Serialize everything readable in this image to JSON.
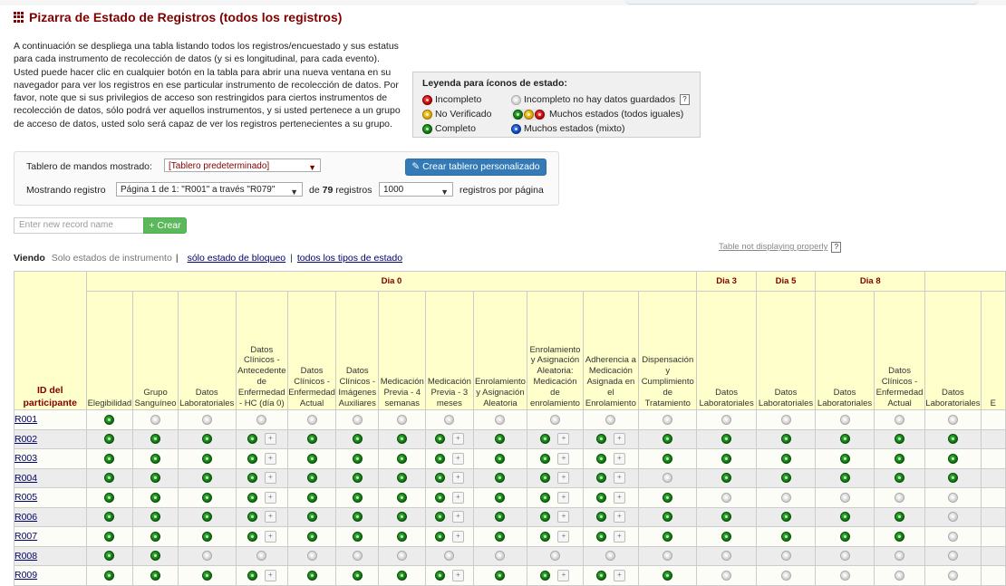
{
  "page": {
    "title": "Pizarra de Estado de Registros (todos los registros)",
    "intro": "A continuación se despliega una tabla listando todos los registros/encuestado y sus estatus para cada instrumento de recolección de datos (y si es longitudinal, para cada evento). Usted puede hacer clic en cualquier botón en la tabla para abrir una nueva ventana en su navegador para ver los registros en ese particular instrumento de recolección de datos. Por favor, note que si sus privilegios de acceso son restringidos para ciertos instrumentos de recolección de datos, sólo podrá ver aquellos instrumentos, y si usted pertenece a un grupo de acceso de datos, usted solo será capaz de ver los registros pertenecientes a su grupo."
  },
  "legend": {
    "title": "Leyenda para íconos de estado:",
    "incomplete": "Incompleto",
    "incomplete_nodata": "Incompleto no hay datos guardados",
    "unverified": "No Verificado",
    "many_same": "Muchos estados (todos iguales)",
    "complete": "Completo",
    "many_mixed": "Muchos estados (mixto)",
    "help": "?"
  },
  "dashboard": {
    "shown_label": "Tablero de mandos mostrado:",
    "shown_value": "[Tablero predeterminado]",
    "create_button": "Crear tablero personalizado",
    "showing_label": "Mostrando registro",
    "page_select": "Página 1 de 1: \"R001\" a través \"R079\"",
    "of_label": "de",
    "total": "79",
    "records_label": "registros",
    "per_page_value": "1000",
    "per_page_label": "registros por página"
  },
  "new_record": {
    "placeholder": "Enter new record name",
    "button": "+ Crear"
  },
  "table_notice": "Table not displaying properly",
  "viewing": {
    "label": "Viendo",
    "current": "Solo estados de instrumento",
    "lock": "sólo estado de bloqueo",
    "all": "todos los tipos de estado"
  },
  "table": {
    "id_header": "ID del participante",
    "events": [
      "Dia 0",
      "Dia 3",
      "Dia 5",
      "Dia 8"
    ],
    "forms": [
      "Elegibilidad",
      "Grupo Sanguíneo",
      "Datos Laboratoriales",
      "Datos Clínicos - Antecedente de Enfermedad - HC (día 0)",
      "Datos Clínicos - Enfermedad Actual",
      "Datos Clínicos - Imágenes Auxiliares",
      "Medicación Previa - 4 semanas",
      "Medicación Previa - 3 meses",
      "Enrolamiento y Asignación Aleatoria",
      "Enrolamiento y Asignación Aleatoria: Medicación de enrolamiento",
      "Adherencia a Medicación Asignada en el Enrolamiento",
      "Dispensación y Cumplimiento de Tratamiento",
      "Datos Laboratoriales",
      "Datos Laboratoriales",
      "Datos Laboratoriales",
      "Datos Clínicos - Enfermedad Actual",
      "Datos Laboratoriales",
      "E"
    ],
    "rows": [
      {
        "id": "R001",
        "s": [
          "g",
          "e",
          "e",
          "e",
          "e",
          "e",
          "e",
          "e",
          "e",
          "e",
          "e",
          "e",
          "e",
          "e",
          "e",
          "e",
          "e"
        ],
        "p": []
      },
      {
        "id": "R002",
        "s": [
          "g",
          "g",
          "g",
          "g",
          "g",
          "g",
          "g",
          "g",
          "g",
          "g",
          "g",
          "g",
          "g",
          "g",
          "g",
          "g",
          "g"
        ],
        "p": [
          3,
          7,
          9,
          10
        ]
      },
      {
        "id": "R003",
        "s": [
          "g",
          "g",
          "g",
          "g",
          "g",
          "g",
          "g",
          "g",
          "g",
          "g",
          "g",
          "g",
          "g",
          "g",
          "g",
          "g",
          "g"
        ],
        "p": [
          3,
          7,
          9,
          10
        ]
      },
      {
        "id": "R004",
        "s": [
          "g",
          "g",
          "g",
          "g",
          "g",
          "g",
          "g",
          "g",
          "g",
          "g",
          "g",
          "e",
          "g",
          "g",
          "g",
          "g",
          "g"
        ],
        "p": [
          3,
          7,
          9,
          10
        ]
      },
      {
        "id": "R005",
        "s": [
          "g",
          "g",
          "g",
          "g",
          "g",
          "g",
          "g",
          "g",
          "g",
          "g",
          "g",
          "g",
          "e",
          "e",
          "e",
          "e",
          "e"
        ],
        "p": [
          3,
          7,
          9,
          10
        ]
      },
      {
        "id": "R006",
        "s": [
          "g",
          "g",
          "g",
          "g",
          "g",
          "g",
          "g",
          "g",
          "g",
          "g",
          "g",
          "g",
          "g",
          "g",
          "g",
          "g",
          "e"
        ],
        "p": [
          3,
          7,
          9,
          10
        ]
      },
      {
        "id": "R007",
        "s": [
          "g",
          "g",
          "g",
          "g",
          "g",
          "g",
          "g",
          "g",
          "g",
          "g",
          "g",
          "g",
          "g",
          "g",
          "g",
          "g",
          "e"
        ],
        "p": [
          3,
          7,
          9,
          10
        ]
      },
      {
        "id": "R008",
        "s": [
          "g",
          "g",
          "e",
          "e",
          "e",
          "e",
          "e",
          "e",
          "e",
          "e",
          "e",
          "e",
          "e",
          "e",
          "e",
          "e",
          "e"
        ],
        "p": []
      },
      {
        "id": "R009",
        "s": [
          "g",
          "g",
          "g",
          "g",
          "g",
          "g",
          "g",
          "g",
          "g",
          "g",
          "g",
          "g",
          "e",
          "e",
          "e",
          "e",
          "e"
        ],
        "p": [
          3,
          7,
          9,
          10
        ]
      }
    ]
  }
}
